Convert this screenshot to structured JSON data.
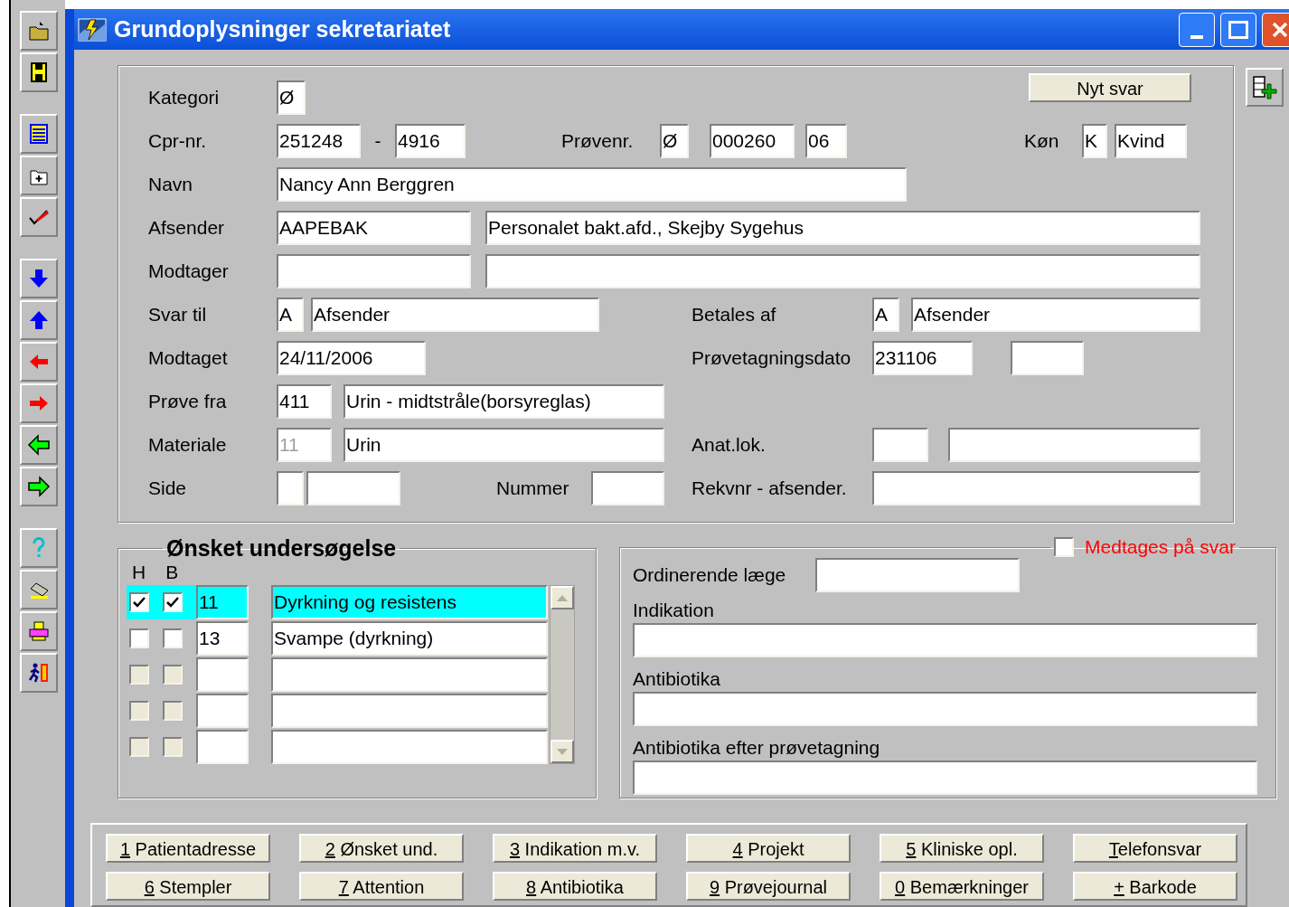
{
  "window": {
    "title": "Grundoplysninger sekretariatet"
  },
  "form": {
    "new_answer_button": "Nyt svar",
    "kategori": {
      "label": "Kategori",
      "value": "Ø"
    },
    "cpr": {
      "label": "Cpr-nr.",
      "date": "251248",
      "separator": "-",
      "number": "4916"
    },
    "proevenr": {
      "label": "Prøvenr.",
      "values": [
        "Ø",
        "000260",
        "06"
      ]
    },
    "koen": {
      "label": "Køn",
      "code": "K",
      "text": "Kvind"
    },
    "navn": {
      "label": "Navn",
      "value": "Nancy Ann Berggren"
    },
    "afsender": {
      "label": "Afsender",
      "code": "AAPEBAK",
      "text": "Personalet bakt.afd., Skejby Sygehus"
    },
    "modtager": {
      "label": "Modtager"
    },
    "svar_til": {
      "label": "Svar til",
      "code": "A",
      "text": "Afsender"
    },
    "betales_af": {
      "label": "Betales af",
      "code": "A",
      "text": "Afsender"
    },
    "modtaget": {
      "label": "Modtaget",
      "value": "24/11/2006"
    },
    "proevetagningsdato": {
      "label": "Prøvetagningsdato",
      "value": "231106"
    },
    "proeve_fra": {
      "label": "Prøve fra",
      "code": "411",
      "text": "Urin - midtstråle(borsyreglas)"
    },
    "materiale": {
      "label": "Materiale",
      "code": "11",
      "code_disabled": true,
      "text": "Urin"
    },
    "anat_lok": {
      "label": "Anat.lok."
    },
    "side": {
      "label": "Side"
    },
    "nummer": {
      "label": "Nummer"
    },
    "rekvnr": {
      "label": "Rekvnr - afsender."
    }
  },
  "examinations": {
    "title": "Ønsket undersøgelse",
    "column_h": "H",
    "column_b": "B",
    "rows": [
      {
        "h_checked": true,
        "b_checked": true,
        "code": "11",
        "description": "Dyrkning og resistens",
        "selected": true,
        "disabled": false
      },
      {
        "h_checked": false,
        "b_checked": false,
        "code": "13",
        "description": "Svampe (dyrkning)",
        "selected": false,
        "disabled": false
      },
      {
        "h_checked": false,
        "b_checked": false,
        "selected": false,
        "disabled": true
      },
      {
        "h_checked": false,
        "b_checked": false,
        "selected": false,
        "disabled": true
      },
      {
        "h_checked": false,
        "b_checked": false,
        "selected": false,
        "disabled": true
      }
    ]
  },
  "details": {
    "include_checkbox": {
      "label": "Medtages på svar",
      "checked": false
    },
    "ordinerende_laege": {
      "label": "Ordinerende læge"
    },
    "indikation": {
      "label": "Indikation"
    },
    "antibiotika": {
      "label": "Antibiotika"
    },
    "antibiotika_efter": {
      "label": "Antibiotika efter prøvetagning"
    }
  },
  "buttons": [
    [
      {
        "key": "1",
        "label": " Patientadresse"
      },
      {
        "key": "2",
        "label": " Ønsket und."
      },
      {
        "key": "3",
        "label": " Indikation m.v."
      },
      {
        "key": "4",
        "label": " Projekt"
      },
      {
        "key": "5",
        "label": " Kliniske opl."
      },
      {
        "key": "T",
        "label": "elefonsvar"
      }
    ],
    [
      {
        "key": "6",
        "label": " Stempler"
      },
      {
        "key": "7",
        "label": " Attention"
      },
      {
        "key": "8",
        "label": " Antibiotika"
      },
      {
        "key": "9",
        "label": " Prøvejournal"
      },
      {
        "key": "0",
        "label": " Bemærkninger"
      },
      {
        "key": "+",
        "label": " Barkode"
      }
    ]
  ]
}
